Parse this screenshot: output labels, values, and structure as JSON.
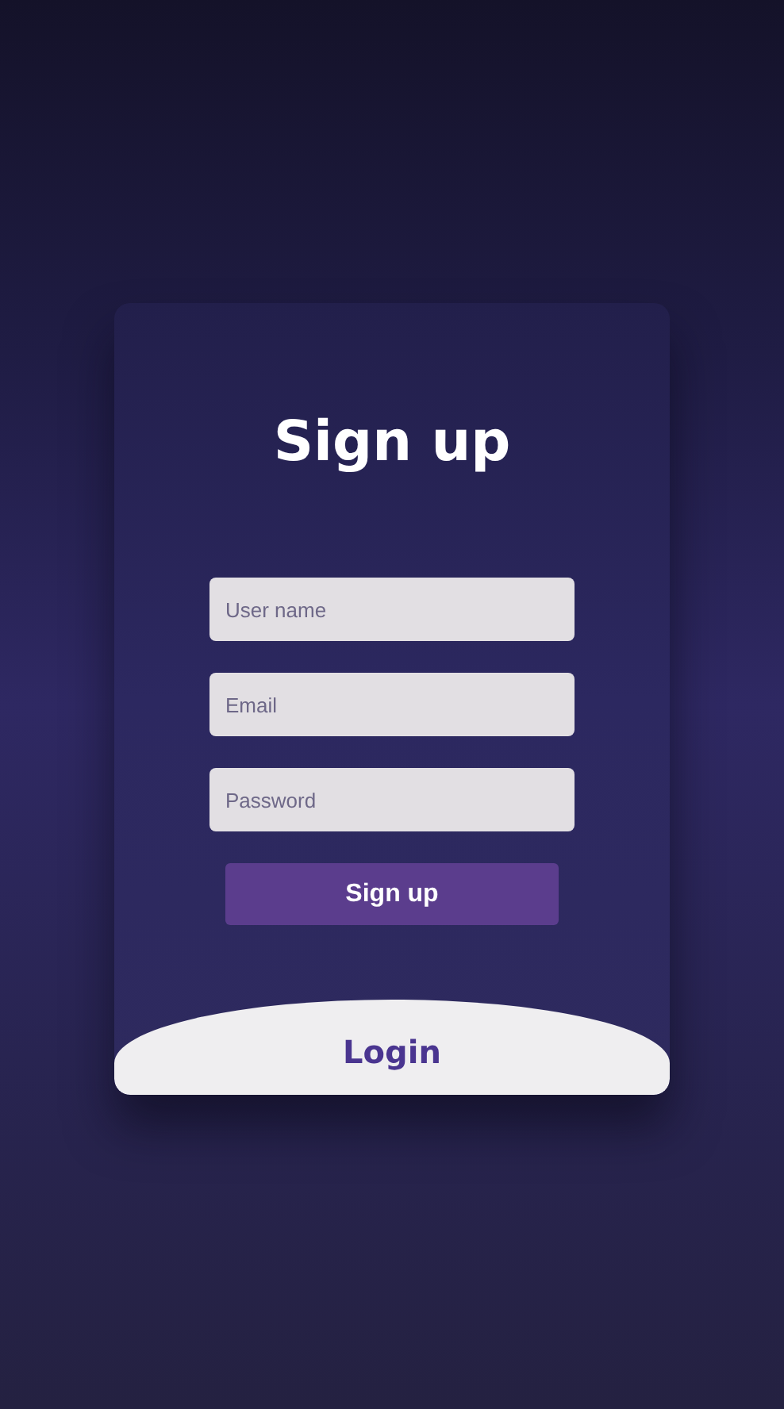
{
  "form": {
    "title": "Sign up",
    "fields": [
      {
        "placeholder": "User name"
      },
      {
        "placeholder": "Email"
      },
      {
        "placeholder": "Password"
      }
    ],
    "submit": "Sign up"
  },
  "login": {
    "label": "Login"
  }
}
